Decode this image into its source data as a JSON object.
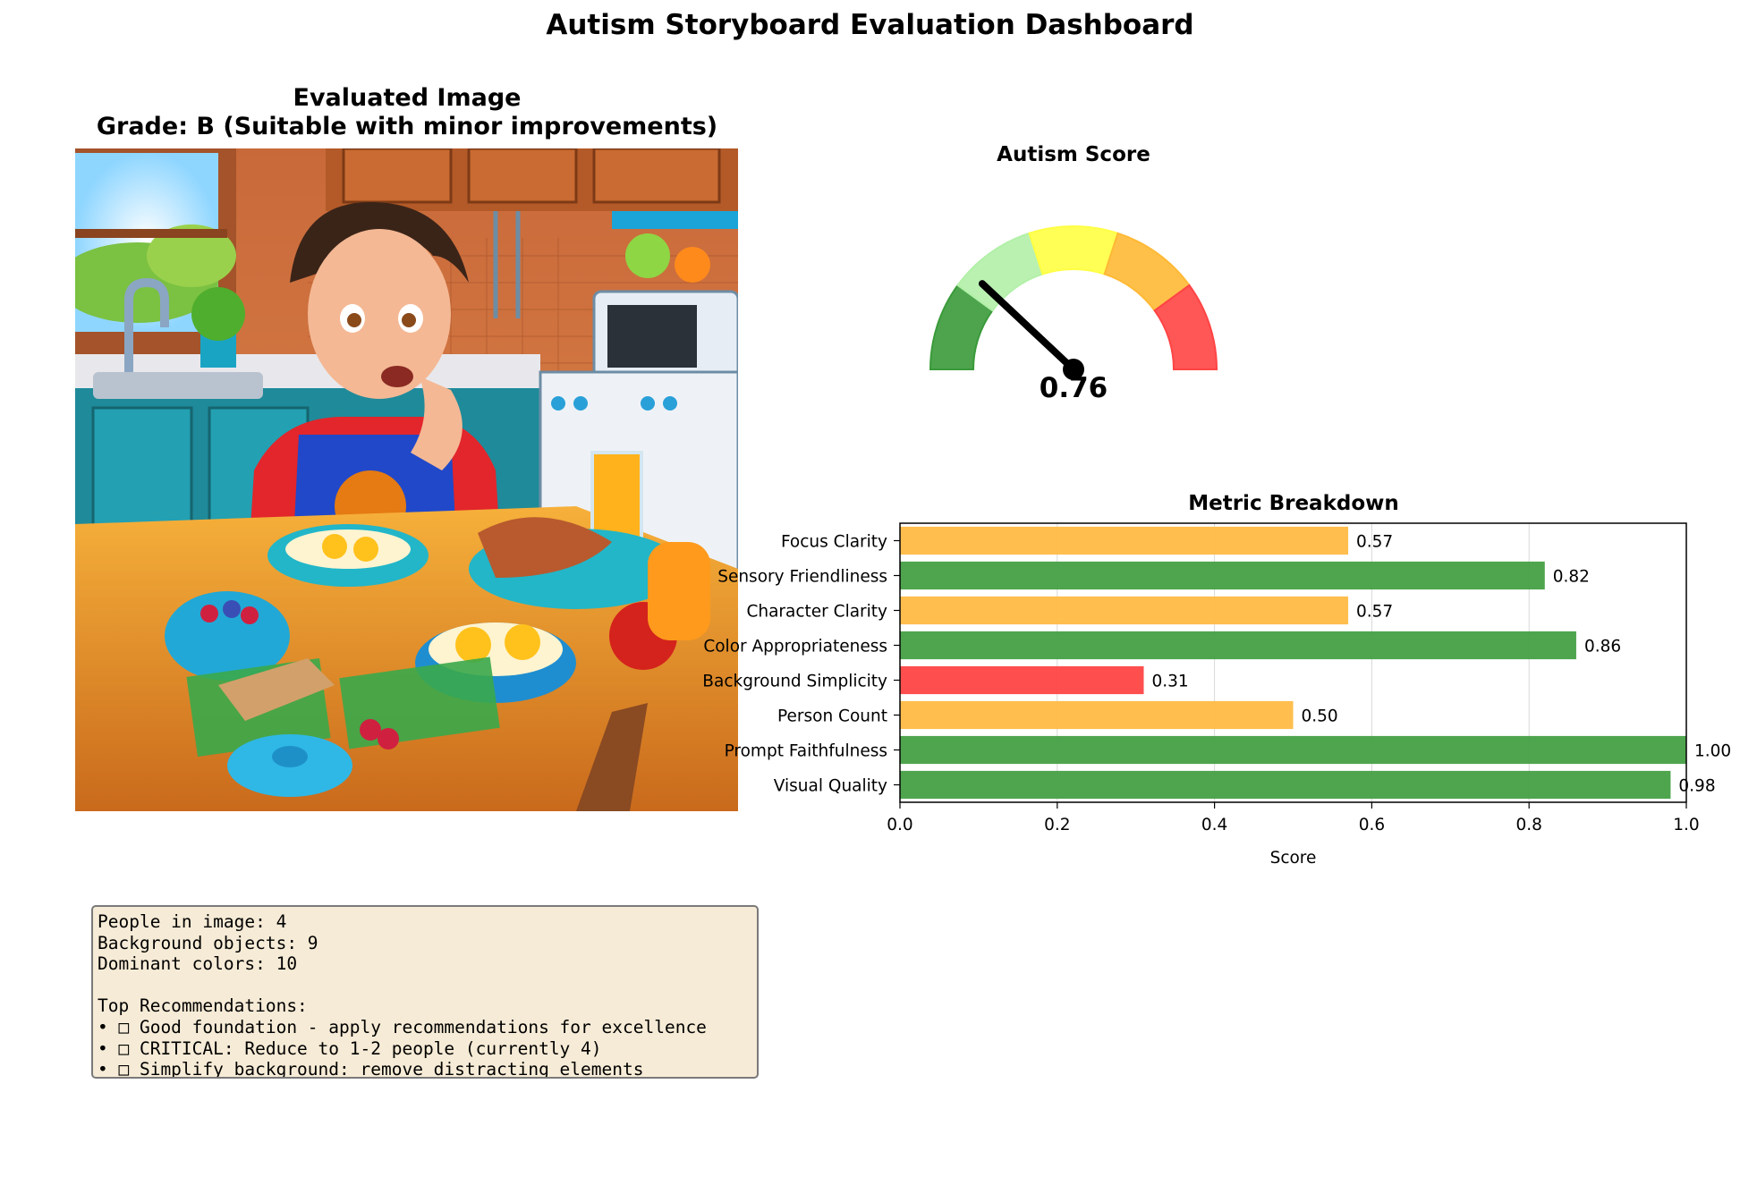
{
  "dashboard_title": "Autism Storyboard Evaluation Dashboard",
  "image_panel": {
    "title_line1": "Evaluated Image",
    "title_line2": "Grade: B (Suitable with minor improvements)"
  },
  "gauge": {
    "title": "Autism Score",
    "value": 0.76,
    "value_label": "0.76",
    "zone_colors": [
      "#3a9a3a",
      "#b2f0a8",
      "#ffff44",
      "#ffb935",
      "#ff4444"
    ]
  },
  "info_box": {
    "stats": [
      "People in image: 4",
      "Background objects: 9",
      "Dominant colors: 10"
    ],
    "recommendations_heading": "Top Recommendations:",
    "recommendations": [
      "• □ Good foundation - apply recommendations for excellence",
      "• □ CRITICAL: Reduce to 1-2 people (currently 4)",
      "• □ Simplify background: remove distracting elements"
    ]
  },
  "colors": {
    "good": "#44a044",
    "medium": "#ffbb44",
    "poor": "#ff4444",
    "info_box_bg": "#f6ebd6"
  },
  "chart_data": {
    "type": "bar",
    "orientation": "horizontal",
    "title": "Metric Breakdown",
    "xlabel": "Score",
    "ylabel": "",
    "xlim": [
      0,
      1.0
    ],
    "x_ticks": [
      "0.0",
      "0.2",
      "0.4",
      "0.6",
      "0.8",
      "1.0"
    ],
    "grid": "vertical",
    "categories": [
      "Focus Clarity",
      "Sensory Friendliness",
      "Character Clarity",
      "Color Appropriateness",
      "Background Simplicity",
      "Person Count",
      "Prompt Faithfulness",
      "Visual Quality"
    ],
    "values": [
      0.57,
      0.82,
      0.57,
      0.86,
      0.31,
      0.5,
      1.0,
      0.98
    ],
    "value_labels": [
      "0.57",
      "0.82",
      "0.57",
      "0.86",
      "0.31",
      "0.50",
      "1.00",
      "0.98"
    ],
    "bar_colors": [
      "#ffbb44",
      "#44a044",
      "#ffbb44",
      "#44a044",
      "#ff4444",
      "#ffbb44",
      "#44a044",
      "#44a044"
    ]
  }
}
